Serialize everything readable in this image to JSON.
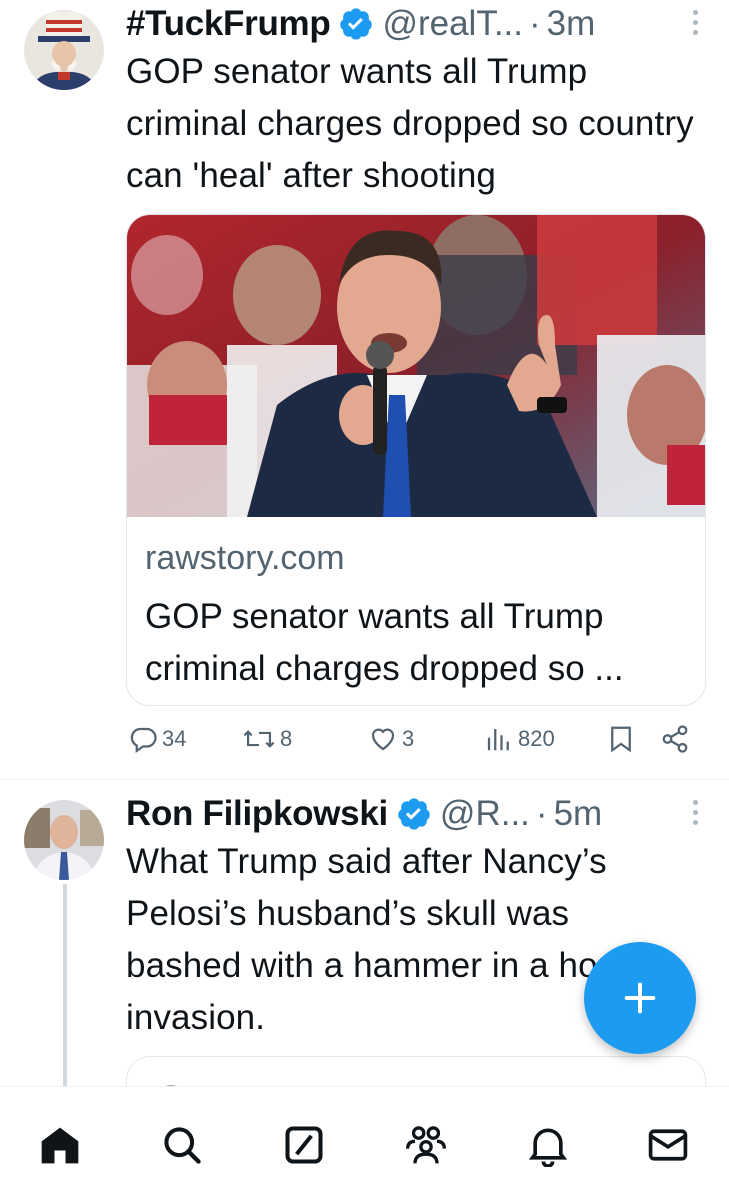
{
  "tweets": [
    {
      "display_name": "#TuckFrump",
      "handle": "@realT...",
      "separator": "·",
      "time": "3m",
      "text": "GOP senator wants all Trump criminal charges dropped so country can 'heal' after shooting",
      "card": {
        "domain": "rawstory.com",
        "title": "GOP senator wants all Trump criminal charges dropped so ..."
      },
      "actions": {
        "replies": "34",
        "retweets": "8",
        "likes": "3",
        "views": "820"
      }
    },
    {
      "display_name": "Ron Filipkowski",
      "handle": "@R...",
      "separator": "·",
      "time": "5m",
      "text": "What Trump said after Nancy’s Pelosi’s husband’s skull was bashed with a hammer in a home invasion."
    }
  ],
  "icons": {
    "verified": "verified-badge-icon",
    "reply": "reply-icon",
    "retweet": "retweet-icon",
    "like": "heart-icon",
    "views": "views-icon",
    "bookmark": "bookmark-icon",
    "share": "share-icon",
    "compose": "plus-icon",
    "nav": [
      "home-icon",
      "search-icon",
      "grok-icon",
      "communities-icon",
      "notifications-icon",
      "messages-icon"
    ]
  },
  "colors": {
    "accent": "#1d9bf0",
    "text": "#0f1419",
    "secondary": "#536471",
    "border": "#e1e8ed"
  }
}
